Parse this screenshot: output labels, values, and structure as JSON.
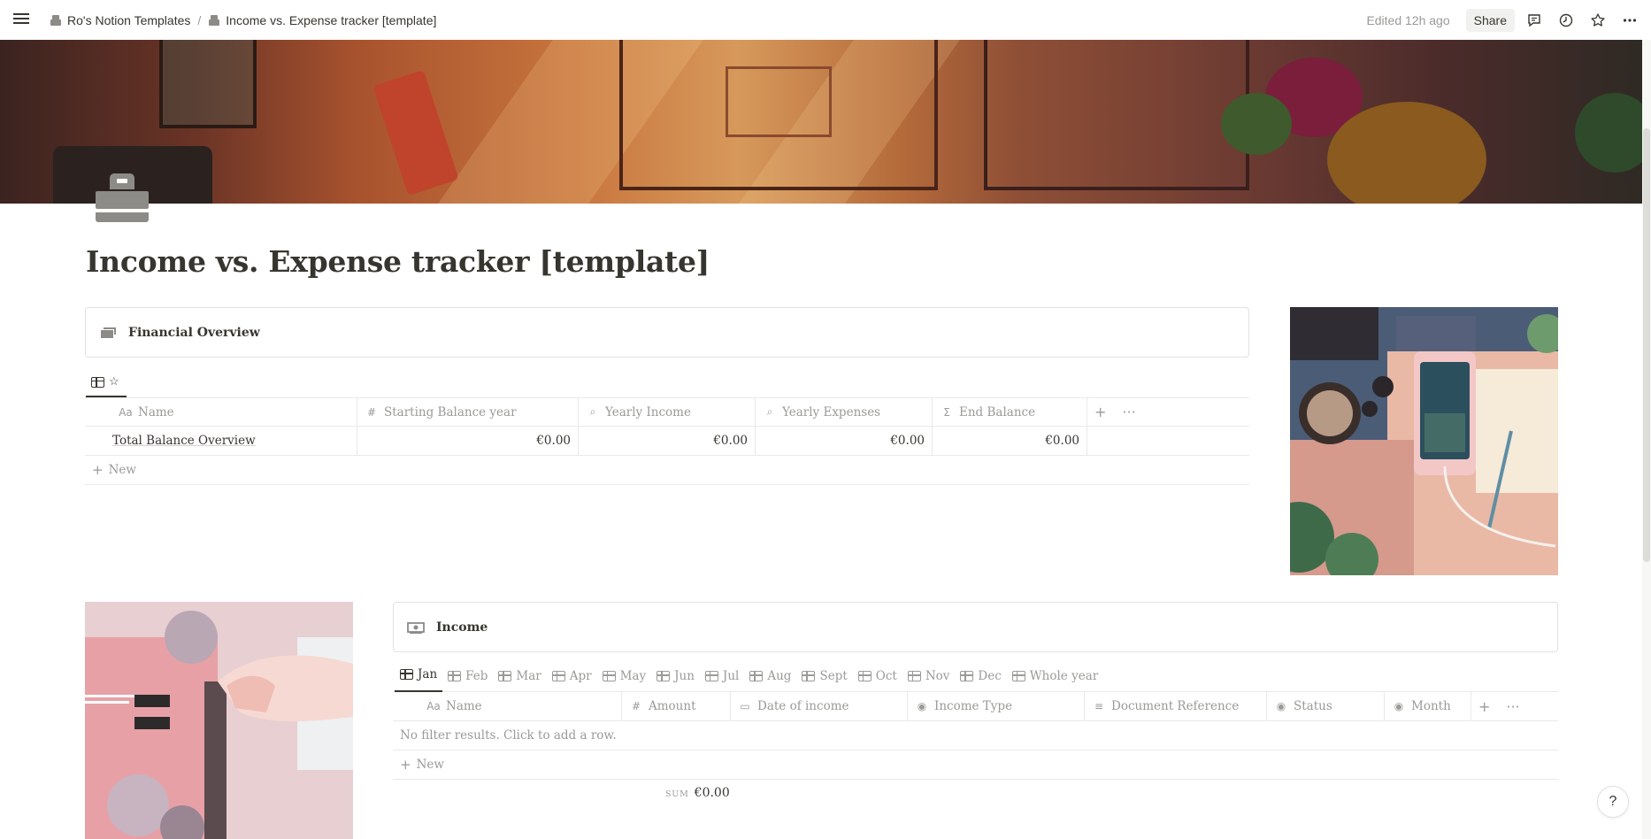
{
  "breadcrumb": {
    "workspace": "Ro's Notion Templates",
    "separator": "/",
    "page": "Income vs. Expense tracker [template]"
  },
  "topbar": {
    "edited": "Edited 12h ago",
    "share_label": "Share"
  },
  "page": {
    "title": "Income vs. Expense tracker [template]",
    "icon": "cash-register-icon"
  },
  "overview": {
    "callout_title": "Financial Overview",
    "view_star": "☆",
    "columns": [
      {
        "icon": "Aa",
        "label": "Name"
      },
      {
        "icon": "#",
        "label": "Starting Balance year"
      },
      {
        "icon": "⌕",
        "label": "Yearly Income"
      },
      {
        "icon": "⌕",
        "label": "Yearly Expenses"
      },
      {
        "icon": "Σ",
        "label": "End Balance"
      }
    ],
    "rows": [
      {
        "name": "Total Balance Overview",
        "starting": "€0.00",
        "income": "€0.00",
        "expenses": "€0.00",
        "end": "€0.00"
      }
    ],
    "new_label": "New"
  },
  "income": {
    "callout_title": "Income",
    "tabs": [
      "Jan",
      "Feb",
      "Mar",
      "Apr",
      "May",
      "Jun",
      "Jul",
      "Aug",
      "Sept",
      "Oct",
      "Nov",
      "Dec",
      "Whole year"
    ],
    "active_tab": "Jan",
    "columns": [
      {
        "icon": "Aa",
        "label": "Name"
      },
      {
        "icon": "#",
        "label": "Amount"
      },
      {
        "icon": "▭",
        "label": "Date of income"
      },
      {
        "icon": "◉",
        "label": "Income Type"
      },
      {
        "icon": "≡",
        "label": "Document Reference"
      },
      {
        "icon": "◉",
        "label": "Status"
      },
      {
        "icon": "◉",
        "label": "Month"
      }
    ],
    "empty_text": "No filter results. Click to add a row.",
    "new_label": "New",
    "sum_label": "SUM",
    "sum_value": "€0.00"
  },
  "help": "?"
}
